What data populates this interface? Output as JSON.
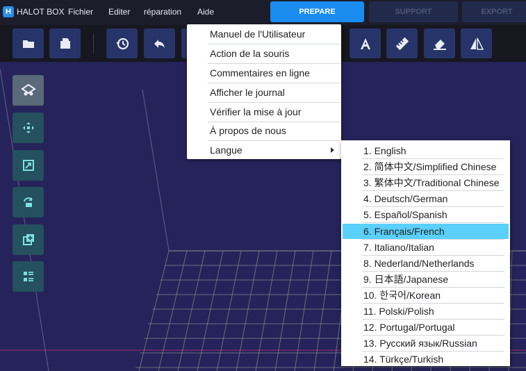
{
  "app": {
    "logo_letter": "H",
    "title": "HALOT BOX"
  },
  "menubar": {
    "items": [
      "Fichier",
      "Editer",
      "réparation",
      "Aide"
    ]
  },
  "tabs": [
    {
      "label": "PREPARE",
      "active": true
    },
    {
      "label": "SUPPORT",
      "active": false
    },
    {
      "label": "EXPORT",
      "active": false
    }
  ],
  "toolbar": {
    "buttons": [
      "open-folder-icon",
      "open-file-icon",
      "history-icon",
      "undo-icon",
      "text-icon",
      "ruler-icon",
      "eraser-icon",
      "mirror-icon"
    ]
  },
  "sidebar": {
    "tools": [
      "layers-icon",
      "move-icon",
      "scale-icon",
      "rotate-icon",
      "duplicate-icon",
      "list-icon"
    ]
  },
  "help_menu": {
    "items": [
      "Manuel de l'Utilisateur",
      "Action de la souris",
      "Commentaires en ligne",
      "Afficher le journal",
      "Vérifier la mise à jour",
      "À propos de nous",
      "Langue"
    ]
  },
  "language_menu": {
    "selected_index": 5,
    "items": [
      "1. English",
      "2. 简体中文/Simplified Chinese",
      "3. 繁体中文/Traditional Chinese",
      "4. Deutsch/German",
      "5. Español/Spanish",
      "6. Français/French",
      "7. Italiano/Italian",
      "8. Nederland/Netherlands",
      "9. 日本語/Japanese",
      "10. 한국어/Korean",
      "11. Polski/Polish",
      "12. Portugal/Portugal",
      "13. Русский язык/Russian",
      "14. Türkçe/Turkish"
    ]
  },
  "colors": {
    "menubar_bg": "#1c1d2b",
    "toolbar_bg": "#17171f",
    "viewport_bg": "#25235a",
    "tab_active": "#1a8cf0",
    "selection": "#5ad0fb"
  }
}
